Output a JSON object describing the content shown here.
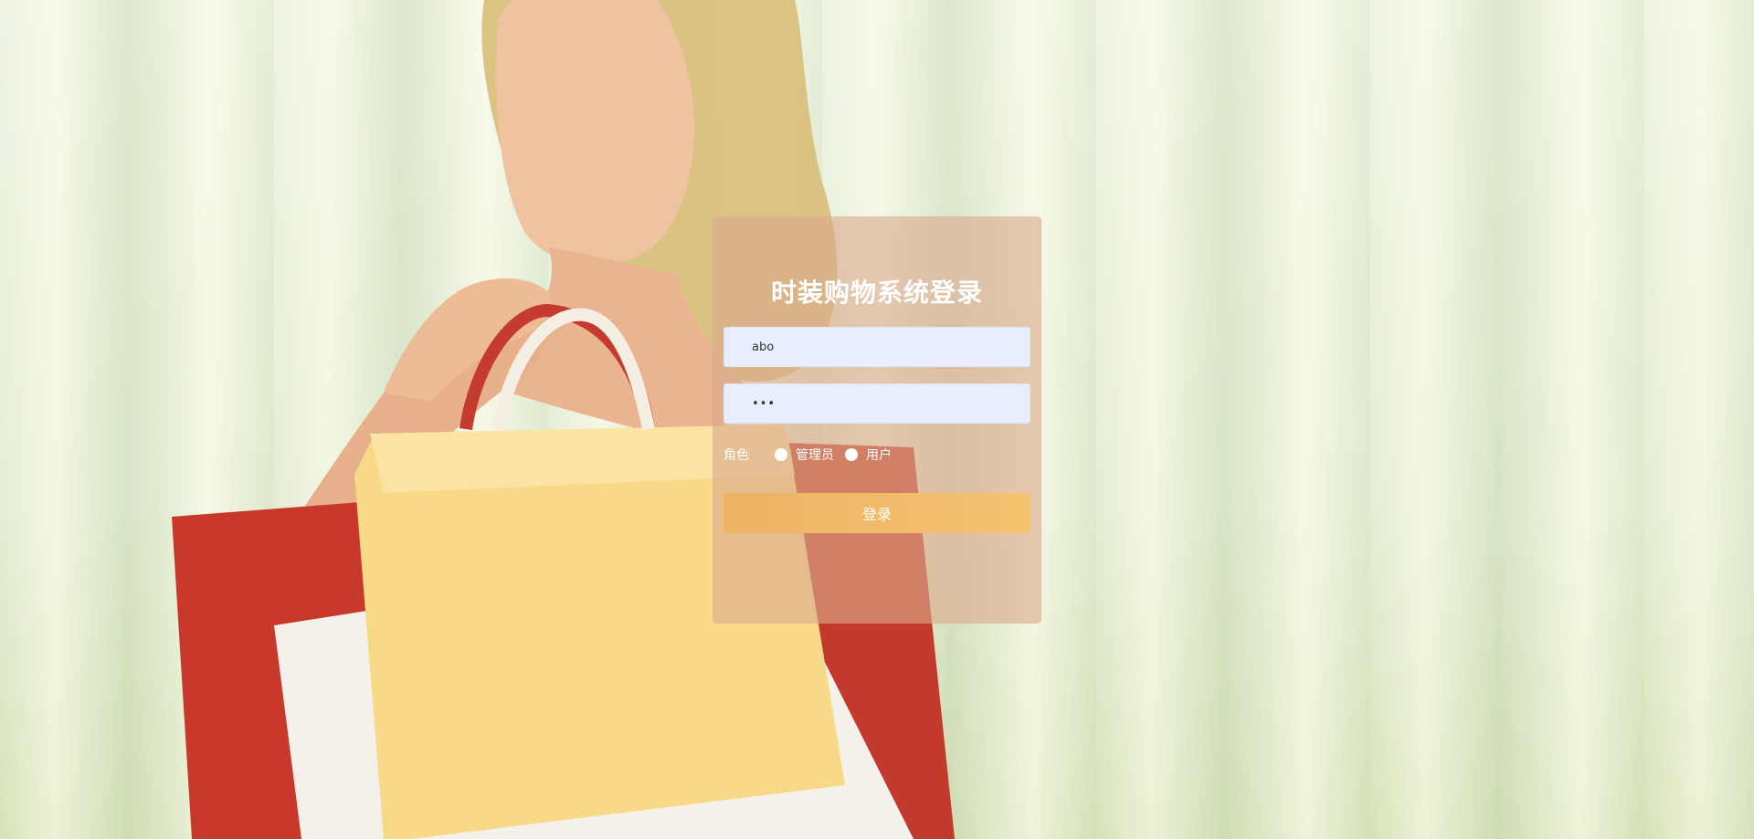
{
  "login": {
    "title": "时装购物系统登录",
    "username_value": "abo",
    "password_value": "•••",
    "role_label": "角色",
    "role_options": [
      {
        "label": "管理员",
        "selected": false
      },
      {
        "label": "用户",
        "selected": false
      }
    ],
    "submit_label": "登录"
  },
  "colors": {
    "card_background": "#daaa8c",
    "input_background": "#e8eefc",
    "button_background": "#f0b865",
    "title_text": "#ffffff"
  }
}
